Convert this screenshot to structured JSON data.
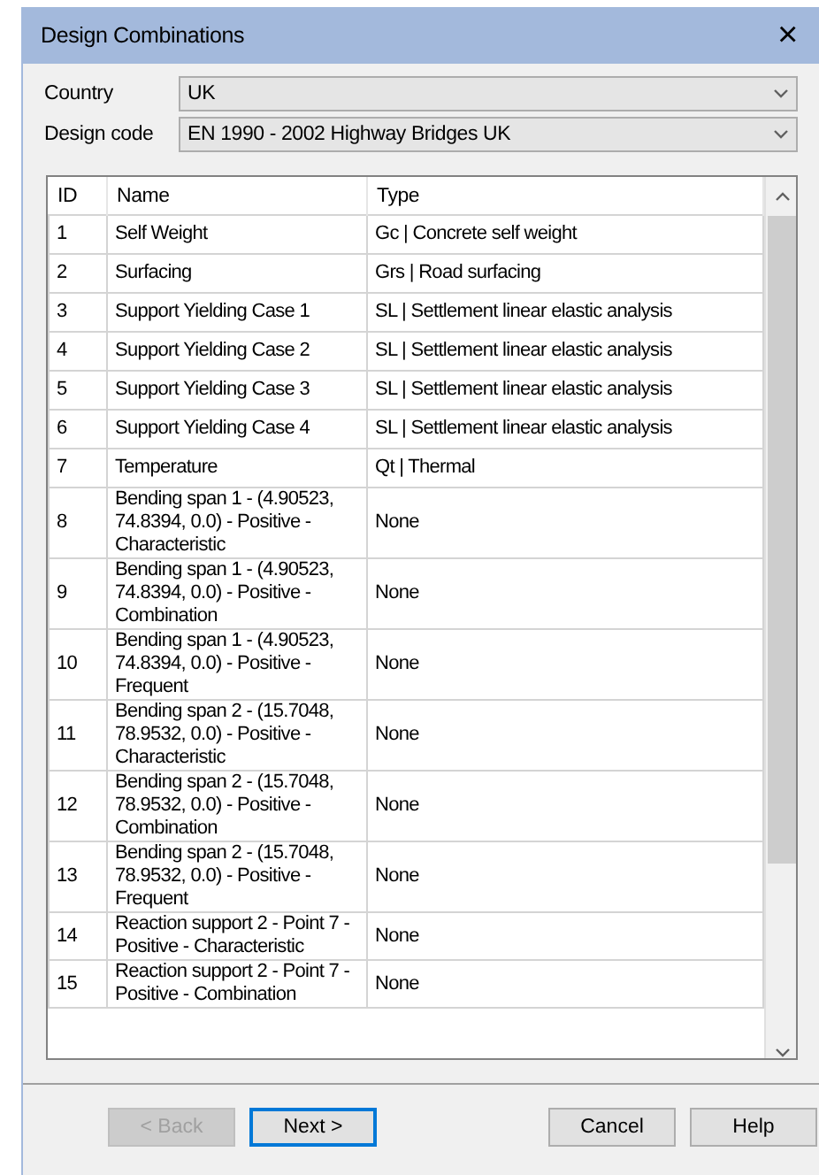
{
  "window": {
    "title": "Design Combinations",
    "close": "×"
  },
  "fields": [
    {
      "label": "Country",
      "value": "UK"
    },
    {
      "label": "Design code",
      "value": "EN 1990 - 2002 Highway Bridges UK"
    }
  ],
  "table": {
    "columns": [
      "ID",
      "Name",
      "Type"
    ],
    "rows": [
      {
        "id": "1",
        "name": "Self Weight",
        "type": "Gc | Concrete self weight"
      },
      {
        "id": "2",
        "name": "Surfacing",
        "type": "Grs | Road surfacing"
      },
      {
        "id": "3",
        "name": "Support Yielding Case 1",
        "type": "SL | Settlement linear elastic analysis"
      },
      {
        "id": "4",
        "name": "Support Yielding Case 2",
        "type": "SL | Settlement linear elastic analysis"
      },
      {
        "id": "5",
        "name": "Support Yielding Case 3",
        "type": "SL | Settlement linear elastic analysis"
      },
      {
        "id": "6",
        "name": "Support Yielding Case 4",
        "type": "SL | Settlement linear elastic analysis"
      },
      {
        "id": "7",
        "name": "Temperature",
        "type": "Qt | Thermal"
      },
      {
        "id": "8",
        "name": "Bending span 1 - (4.90523, 74.8394, 0.0) - Positive - Characteristic",
        "type": "None"
      },
      {
        "id": "9",
        "name": "Bending span 1 - (4.90523, 74.8394, 0.0) - Positive - Combination",
        "type": "None"
      },
      {
        "id": "10",
        "name": "Bending span 1 - (4.90523, 74.8394, 0.0) - Positive - Frequent",
        "type": "None"
      },
      {
        "id": "11",
        "name": "Bending span 2 - (15.7048, 78.9532, 0.0) - Positive - Characteristic",
        "type": "None"
      },
      {
        "id": "12",
        "name": "Bending span 2 - (15.7048, 78.9532, 0.0) - Positive - Combination",
        "type": "None"
      },
      {
        "id": "13",
        "name": "Bending span 2 - (15.7048, 78.9532, 0.0) - Positive - Frequent",
        "type": "None"
      },
      {
        "id": "14",
        "name": "Reaction support 2 - Point 7 - Positive - Characteristic",
        "type": "None"
      },
      {
        "id": "15",
        "name": "Reaction support 2 - Point 7 - Positive - Combination",
        "type": "None"
      }
    ]
  },
  "buttons": [
    {
      "label": "< Back",
      "disabled": true,
      "default": false
    },
    {
      "label": "Next >",
      "disabled": false,
      "default": true
    },
    {
      "label": "Cancel",
      "disabled": false,
      "default": false
    },
    {
      "label": "Help",
      "disabled": false,
      "default": false
    }
  ]
}
